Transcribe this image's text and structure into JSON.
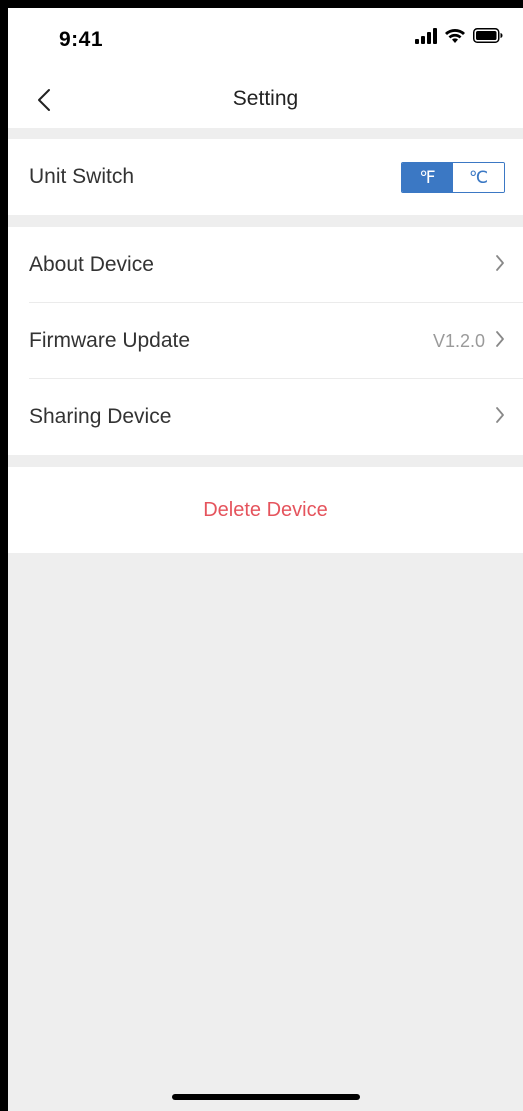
{
  "status_bar": {
    "time": "9:41",
    "icons": [
      "cellular-signal-icon",
      "wifi-icon",
      "battery-icon"
    ]
  },
  "nav": {
    "back_icon": "chevron-left-icon",
    "title": "Setting"
  },
  "unit_section": {
    "label": "Unit Switch",
    "options": [
      "℉",
      "℃"
    ],
    "selected": "℉"
  },
  "device_section": {
    "about_label": "About Device",
    "firmware_label": "Firmware Update",
    "firmware_version": "V1.2.0",
    "sharing_label": "Sharing Device",
    "chevron_icon": "chevron-right-icon"
  },
  "delete_section": {
    "label": "Delete Device"
  },
  "colors": {
    "accent": "#3b78c4",
    "danger": "#e5545d",
    "page_background": "#eeeeee"
  }
}
